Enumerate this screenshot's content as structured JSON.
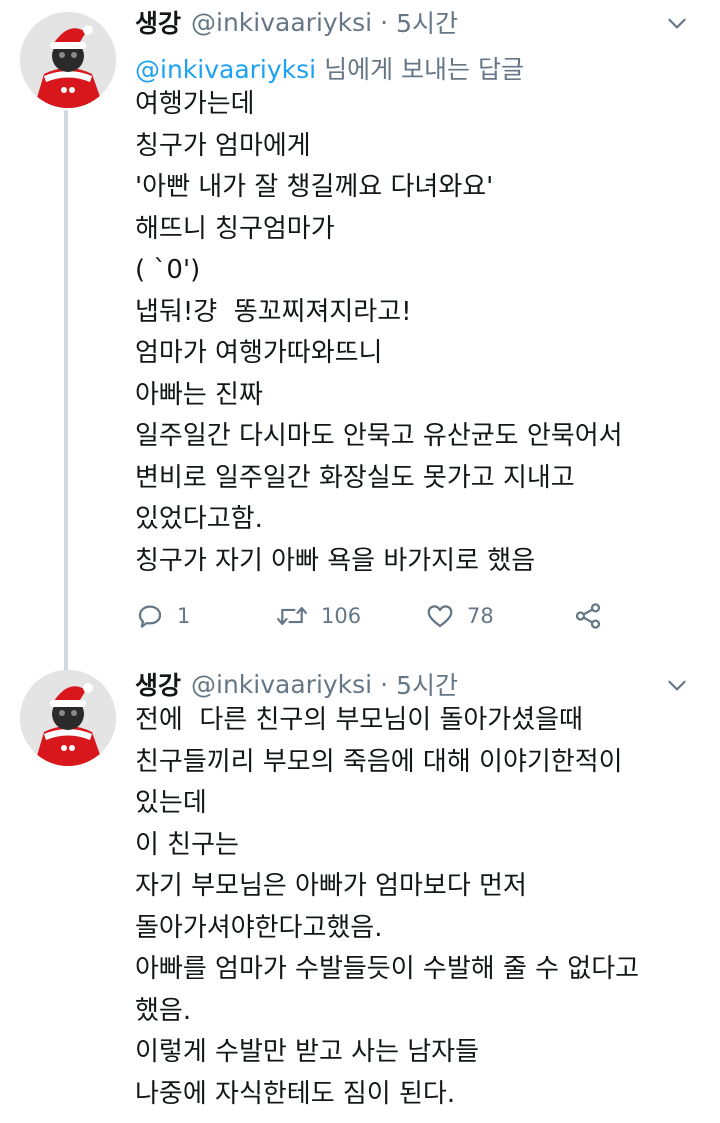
{
  "tweets": [
    {
      "name": "생강",
      "handle": "@inkivaariyksi",
      "dot": "·",
      "time": "5시간",
      "reply_to": {
        "mention": "@inkivaariyksi",
        "suffix": " 님에게 보내는 답글"
      },
      "lines": [
        "여행가는데",
        "칭구가 엄마에게",
        "'아빤 내가 잘 챙길께요 다녀와요'",
        "해뜨니 칭구엄마가",
        "( `0')",
        "냅둬!걍  똥꼬찌져지라고!",
        "엄마가 여행가따와뜨니",
        "아빠는 진짜",
        "일주일간 다시마도 안묵고 유산균도 안묵어서",
        "변비로 일주일간 화장실도 못가고 지내고",
        "있었다고함.",
        "칭구가 자기 아빠 욕을 바가지로 했음"
      ],
      "actions": {
        "reply_count": "1",
        "retweet_count": "106",
        "like_count": "78"
      }
    },
    {
      "name": "생강",
      "handle": "@inkivaariyksi",
      "dot": "·",
      "time": "5시간",
      "lines": [
        "전에  다른 친구의 부모님이 돌아가셨을때",
        "친구들끼리 부모의 죽음에 대해 이야기한적이",
        "있는데",
        "이 친구는",
        "자기 부모님은 아빠가 엄마보다 먼저",
        "돌아가셔야한다고했음.",
        "아빠를 엄마가 수발들듯이 수발해 줄 수 없다고",
        "했음.",
        "이렇게 수발만 받고 사는 남자들",
        "나중에 자식한테도 짐이 된다."
      ]
    }
  ],
  "colors": {
    "accent": "#1da1f2",
    "secondary_text": "#657786",
    "primary_text": "#14171a",
    "thread_line": "#cfd9de"
  },
  "icons": {
    "avatar": "santa-avatar-icon",
    "menu": "chevron-down-icon",
    "reply": "reply-bubble-icon",
    "retweet": "retweet-icon",
    "like": "heart-icon",
    "share": "share-icon"
  }
}
